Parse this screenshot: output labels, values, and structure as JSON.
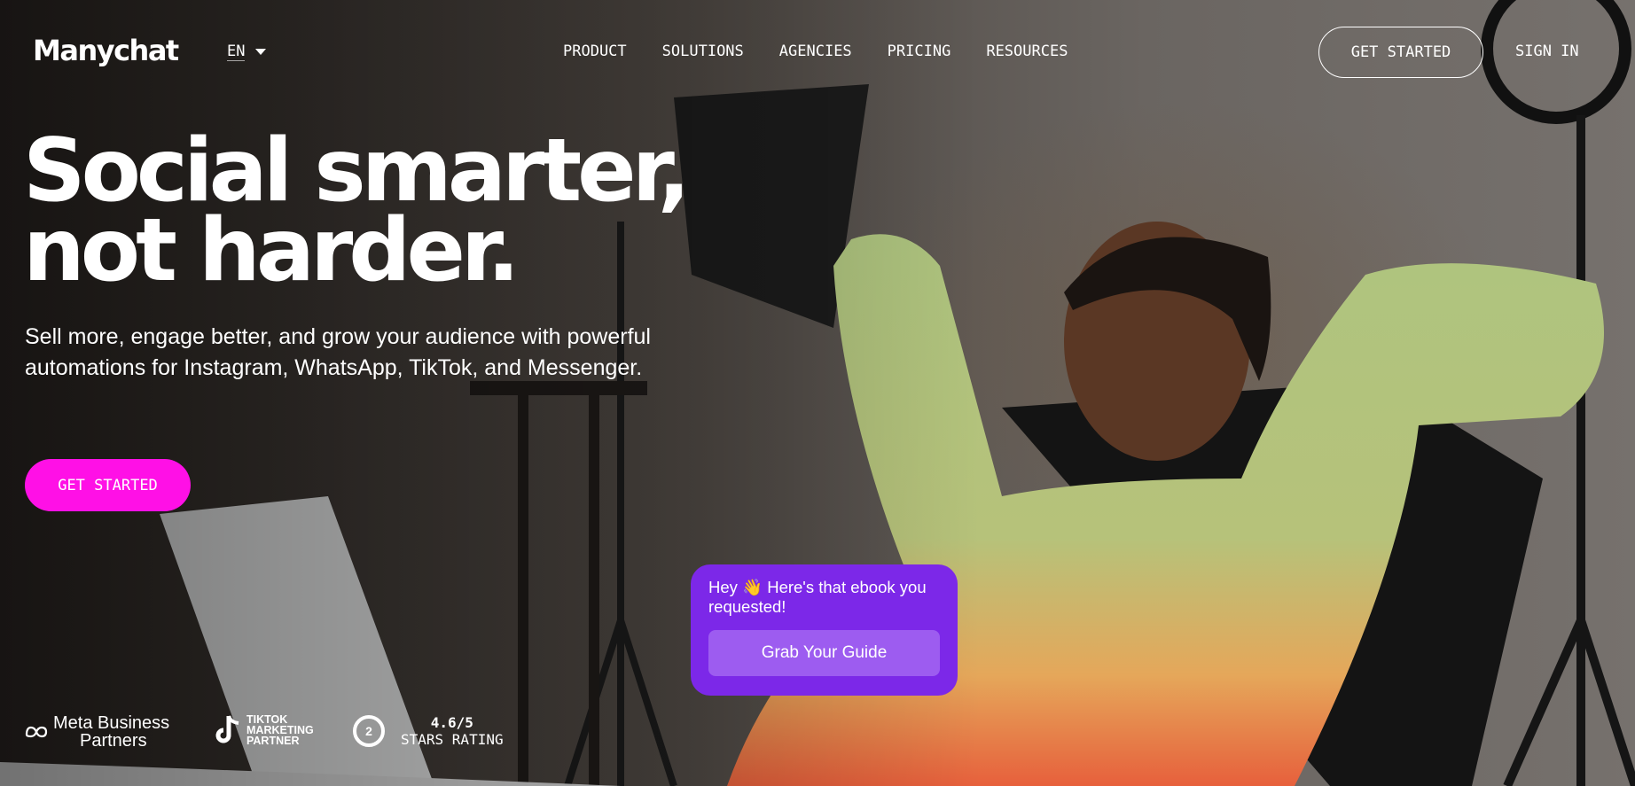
{
  "header": {
    "logo": "Manychat",
    "language": "EN",
    "nav": [
      "PRODUCT",
      "SOLUTIONS",
      "AGENCIES",
      "PRICING",
      "RESOURCES"
    ],
    "get_started": "GET STARTED",
    "sign_in": "SIGN IN"
  },
  "hero": {
    "title_line1": "Social smarter,",
    "title_line2": "not harder.",
    "subtitle": "Sell more, engage better, and grow your audience with powerful automations for Instagram, WhatsApp, TikTok, and Messenger.",
    "cta": "GET STARTED"
  },
  "chat": {
    "message": "Hey 👋 Here's that ebook you requested!",
    "button": "Grab Your Guide"
  },
  "badges": {
    "meta_line1": "Meta Business",
    "meta_line2": "Partners",
    "tiktok_line1": "TIKTOK",
    "tiktok_line2": "MARKETING",
    "tiktok_line3": "PARTNER",
    "g2_logo": "2",
    "rating_value": "4.6/5",
    "rating_label": "STARS RATING"
  },
  "colors": {
    "cta": "#ff10e6",
    "chat_card": "#7c28e8",
    "chat_button": "#9d5cf0",
    "sweater": "#a9c27c"
  }
}
